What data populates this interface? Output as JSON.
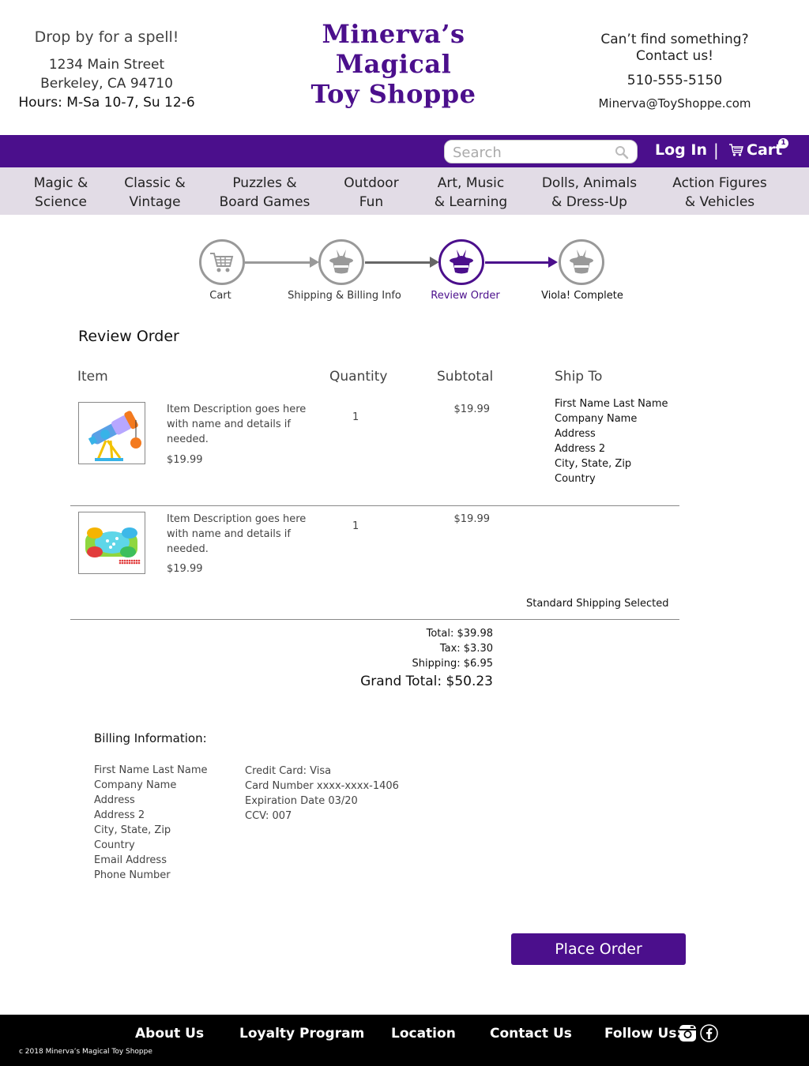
{
  "header": {
    "tagline": "Drop by for a spell!",
    "address_line1": "1234 Main Street",
    "address_line2": "Berkeley, CA 94710",
    "hours": "Hours: M-Sa 10-7, Su 12-6",
    "logo_line1": "Minerva’s",
    "logo_line2": "Magical",
    "logo_line3": "Toy Shoppe",
    "contact_line1": "Can’t find something?",
    "contact_line2": "Contact us!",
    "phone": "510-555-5150",
    "email": "Minerva@ToyShoppe.com"
  },
  "topbar": {
    "search_placeholder": "Search",
    "login": "Log In",
    "separator": "|",
    "cart_label": "Cart",
    "cart_count": "1"
  },
  "categories": [
    {
      "line1": "Magic &",
      "line2": "Science"
    },
    {
      "line1": "Classic &",
      "line2": "Vintage"
    },
    {
      "line1": "Puzzles &",
      "line2": "Board Games"
    },
    {
      "line1": "Outdoor",
      "line2": "Fun"
    },
    {
      "line1": "Art, Music",
      "line2": "& Learning"
    },
    {
      "line1": "Dolls, Animals",
      "line2": "& Dress-Up"
    },
    {
      "line1": "Action Figures",
      "line2": "& Vehicles"
    }
  ],
  "steps": [
    {
      "label": "Cart",
      "state": "done"
    },
    {
      "label": "Shipping & Billing Info",
      "state": "done"
    },
    {
      "label": "Review Order",
      "state": "active"
    },
    {
      "label": "Viola! Complete",
      "state": "pending"
    }
  ],
  "review": {
    "title": "Review Order",
    "col_item": "Item",
    "col_quantity": "Quantity",
    "col_subtotal": "Subtotal",
    "col_shipto": "Ship To",
    "items": [
      {
        "desc_line1": "Item Description goes here",
        "desc_line2": "with name and details if",
        "desc_line3": "needed.",
        "price": "$19.99",
        "quantity": "1",
        "subtotal": "$19.99"
      },
      {
        "desc_line1": "Item Description goes here",
        "desc_line2": "with name and details if",
        "desc_line3": "needed.",
        "price": "$19.99",
        "quantity": "1",
        "subtotal": "$19.99"
      }
    ],
    "ship_to": [
      "First Name Last Name",
      "Company Name",
      "Address",
      "Address 2",
      "City, State, Zip",
      "Country"
    ],
    "shipping_selected": "Standard Shipping Selected",
    "total": "Total: $39.98",
    "tax": "Tax: $3.30",
    "shipping": "Shipping: $6.95",
    "grand_total": "Grand Total: $50.23"
  },
  "billing": {
    "title": "Billing Information:",
    "address": [
      "First Name Last Name",
      "Company Name",
      "Address",
      "Address 2",
      "City, State, Zip",
      "Country",
      "Email Address",
      "Phone Number"
    ],
    "card": [
      "Credit Card: Visa",
      "Card Number xxxx-xxxx-1406",
      "Expiration Date 03/20",
      "CCV: 007"
    ]
  },
  "place_order": "Place Order",
  "footer": {
    "about": "About Us",
    "loyalty": "Loyalty Program",
    "location": "Location",
    "contact": "Contact Us",
    "follow": "Follow Us:",
    "copyright": "c 2018 Minerva’s Magical Toy Shoppe"
  },
  "colors": {
    "brand_purple": "#4b0f8c",
    "nav_bg": "#e2dce6",
    "footer_bg": "#000000",
    "inactive_gray": "#999999"
  },
  "icons": [
    "search-icon",
    "cart-icon",
    "shopping-cart-icon",
    "magic-hat-icon",
    "instagram-icon",
    "facebook-icon"
  ]
}
